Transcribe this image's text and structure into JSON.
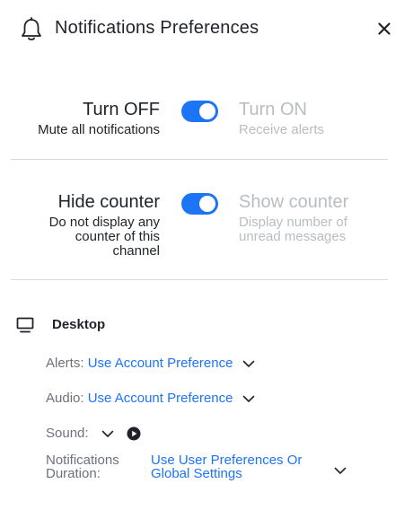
{
  "header": {
    "title": "Notifications Preferences",
    "icon": "bell-icon",
    "close_icon": "close-icon"
  },
  "mute": {
    "off_title": "Turn OFF",
    "off_desc": "Mute all notifications",
    "on_title": "Turn ON",
    "on_desc": "Receive alerts",
    "toggle_on": true
  },
  "counter": {
    "hide_title": "Hide counter",
    "hide_desc_lines": [
      "Do not display any",
      "counter of this",
      "channel"
    ],
    "show_title": "Show counter",
    "show_desc_lines": [
      "Display number of",
      "unread messages"
    ],
    "toggle_on": true
  },
  "desktop": {
    "icon": "monitor-icon",
    "label": "Desktop",
    "alerts_label": "Alerts:",
    "alerts_value": "Use Account Preference",
    "audio_label": "Audio:",
    "audio_value": "Use Account Preference",
    "sound_label": "Sound:",
    "duration_label_lines": [
      "Notifications",
      "Duration:"
    ],
    "duration_value_lines": [
      "Use User Preferences Or",
      "Global Settings"
    ]
  },
  "colors": {
    "accent": "#1d74f5",
    "muted_text": "#b9bdc2",
    "divider": "#d7dadf"
  }
}
